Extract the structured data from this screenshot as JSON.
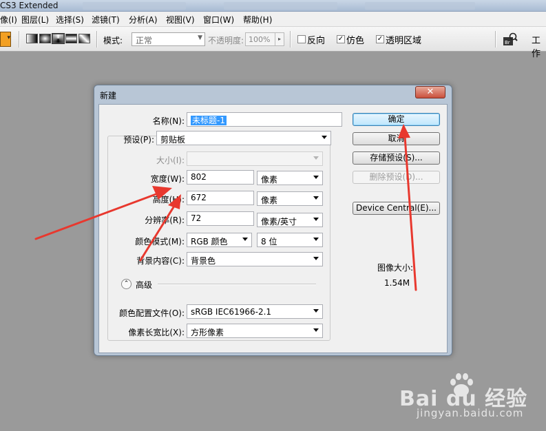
{
  "window": {
    "title": "CS3 Extended"
  },
  "menu": [
    "像(I)",
    "图层(L)",
    "选择(S)",
    "滤镜(T)",
    "分析(A)",
    "视图(V)",
    "窗口(W)",
    "帮助(H)"
  ],
  "options": {
    "mode_label": "模式:",
    "mode_value": "正常",
    "opacity_label": "不透明度:",
    "opacity_value": "100%",
    "reverse_label": "反向",
    "dither_label": "仿色",
    "transparency_label": "透明区域",
    "reverse_checked": false,
    "dither_checked": true,
    "transparency_checked": true,
    "workspace_label": "工作"
  },
  "dialog": {
    "title": "新建",
    "close_glyph": "✕",
    "name_label": "名称(N):",
    "name_value": "未标题-1",
    "preset_label": "预设(P):",
    "preset_value": "剪贴板",
    "size_label": "大小(I):",
    "width_label": "宽度(W):",
    "width_value": "802",
    "width_unit": "像素",
    "height_label": "高度(H):",
    "height_value": "672",
    "height_unit": "像素",
    "resolution_label": "分辨率(R):",
    "resolution_value": "72",
    "resolution_unit": "像素/英寸",
    "color_mode_label": "颜色模式(M):",
    "color_mode_value": "RGB 颜色",
    "bit_depth_value": "8 位",
    "background_label": "背景内容(C):",
    "background_value": "背景色",
    "advanced_label": "高级",
    "advanced_glyph": "⌃",
    "color_profile_label": "颜色配置文件(O):",
    "color_profile_value": "sRGB IEC61966-2.1",
    "pixel_aspect_label": "像素长宽比(X):",
    "pixel_aspect_value": "方形像素",
    "buttons": {
      "ok": "确定",
      "cancel": "取消",
      "save_preset": "存储预设(S)...",
      "delete_preset": "删除预设(D)...",
      "device_central": "Device Central(E)..."
    },
    "image_size_label": "图像大小:",
    "image_size_value": "1.54M"
  },
  "watermark": {
    "logo_text": "Bai du 经验",
    "url": "jingyan.baidu.com"
  },
  "colors": {
    "annotation_arrow": "#e8382e",
    "desktop": "#9a9a9a"
  }
}
